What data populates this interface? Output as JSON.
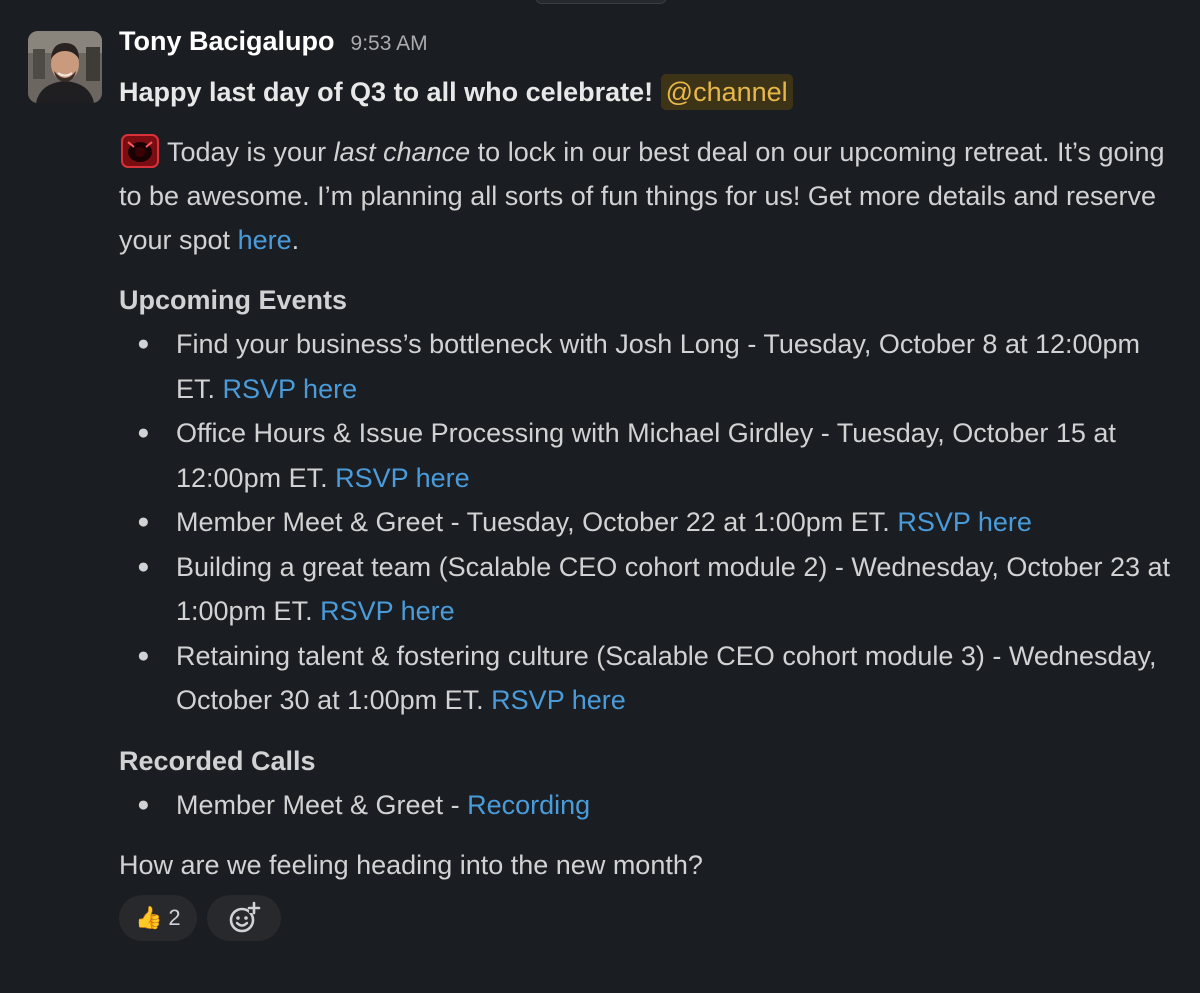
{
  "message": {
    "sender": "Tony Bacigalupo",
    "time": "9:53 AM",
    "headline": "Happy last day of Q3 to all who celebrate!",
    "mention": "@channel",
    "intro": {
      "before_em": "Today is your ",
      "em": "last chance",
      "after_em": " to lock in our best deal on our upcoming retreat. It’s going to be awesome. I’m planning all sorts of fun things for us! Get more details and reserve your spot ",
      "link": "here",
      "end": "."
    },
    "upcoming_title": "Upcoming Events",
    "events": [
      {
        "text": "Find your business’s bottleneck with Josh Long - Tuesday, October 8 at 12:00pm ET. ",
        "link": "RSVP here"
      },
      {
        "text": "Office Hours & Issue Processing with Michael Girdley - Tuesday, October 15 at 12:00pm ET. ",
        "link": "RSVP here"
      },
      {
        "text": "Member Meet & Greet - Tuesday, October 22 at 1:00pm ET. ",
        "link": "RSVP here"
      },
      {
        "text": "Building a great team (Scalable CEO cohort module 2) - Wednesday, October 23 at 1:00pm ET. ",
        "link": "RSVP here"
      },
      {
        "text": "Retaining talent & fostering culture (Scalable CEO cohort module 3) - Wednesday, October 30 at 1:00pm ET. ",
        "link": "RSVP here"
      }
    ],
    "recorded_title": "Recorded Calls",
    "recordings": [
      {
        "text": "Member Meet & Greet - ",
        "link": "Recording"
      }
    ],
    "question": "How are we feeling heading into the new month?",
    "reactions": [
      {
        "emoji": "👍",
        "count": "2",
        "icon": "thumbs-up-icon"
      }
    ],
    "add_reaction_icon": "add-reaction-icon",
    "bullet": "●"
  },
  "colors": {
    "background": "#1a1d21",
    "link": "#4a9bd9",
    "mention_text": "#e8b74a",
    "mention_bg": "#3d3418"
  }
}
